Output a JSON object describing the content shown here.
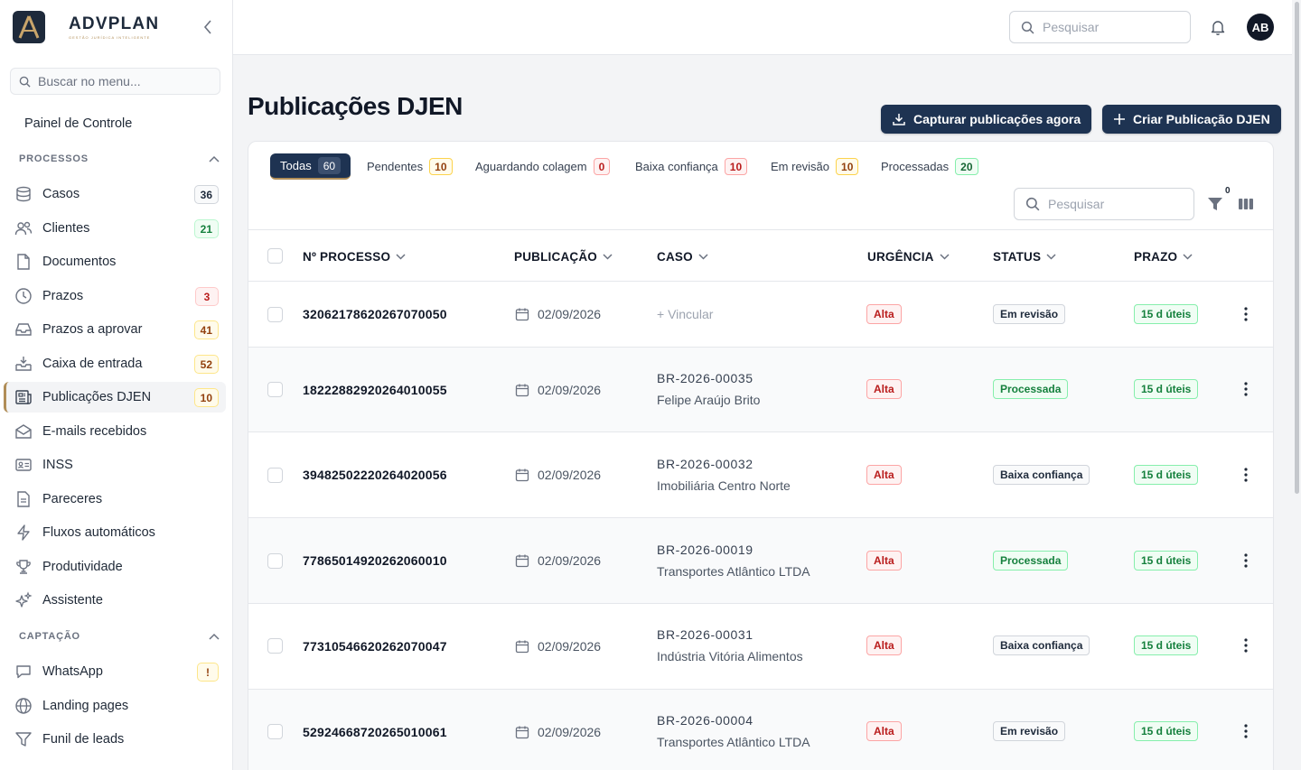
{
  "brand": {
    "name": "ADVPLAN",
    "subtitle": "GESTÃO JURÍDICA INTELIGENTE",
    "logo_letter": "A"
  },
  "sidebar": {
    "search_placeholder": "Buscar no menu...",
    "top_item": {
      "label": "Painel de Controle",
      "icon": "dashboard-icon"
    },
    "sections": [
      {
        "label": "PROCESSOS"
      },
      {
        "label": "CAPTAÇÃO"
      }
    ],
    "items": [
      {
        "label": "Casos",
        "badge": "36",
        "icon": "database-icon"
      },
      {
        "label": "Clientes",
        "badge": "21",
        "icon": "users-icon"
      },
      {
        "label": "Documentos",
        "badge": "",
        "icon": "file-icon"
      },
      {
        "label": "Prazos",
        "badge": "3",
        "icon": "clock-icon"
      },
      {
        "label": "Prazos a aprovar",
        "badge": "41",
        "icon": "inbox-icon"
      },
      {
        "label": "Caixa de entrada",
        "badge": "52",
        "icon": "inbox-download-icon"
      },
      {
        "label": "Publicações DJEN",
        "badge": "10",
        "icon": "newspaper-icon"
      },
      {
        "label": "E-mails recebidos",
        "badge": "",
        "icon": "mail-icon"
      },
      {
        "label": "INSS",
        "badge": "",
        "icon": "id-card-icon"
      },
      {
        "label": "Pareceres",
        "badge": "",
        "icon": "document-text-icon"
      },
      {
        "label": "Fluxos automáticos",
        "badge": "",
        "icon": "lightning-icon"
      },
      {
        "label": "Produtividade",
        "badge": "",
        "icon": "trophy-icon"
      },
      {
        "label": "Assistente",
        "badge": "",
        "icon": "sparkles-icon"
      },
      {
        "label": "WhatsApp",
        "badge": "!",
        "icon": "chat-icon"
      },
      {
        "label": "Landing pages",
        "badge": "",
        "icon": "globe-icon"
      },
      {
        "label": "Funil de leads",
        "badge": "",
        "icon": "funnel-icon"
      }
    ]
  },
  "topbar": {
    "search_placeholder": "Pesquisar",
    "avatar": "AB"
  },
  "page": {
    "title": "Publicações DJEN",
    "btn_capture": "Capturar publicações agora",
    "btn_create": "Criar Publicação DJEN"
  },
  "tabs": [
    {
      "label": "Todas",
      "count": "60"
    },
    {
      "label": "Pendentes",
      "count": "10"
    },
    {
      "label": "Aguardando colagem",
      "count": "0"
    },
    {
      "label": "Baixa confiança",
      "count": "10"
    },
    {
      "label": "Em revisão",
      "count": "10"
    },
    {
      "label": "Processadas",
      "count": "20"
    }
  ],
  "table": {
    "search_placeholder": "Pesquisar",
    "filter_count": "0",
    "columns": [
      "Nº PROCESSO",
      "PUBLICAÇÃO",
      "CASO",
      "URGÊNCIA",
      "STATUS",
      "PRAZO"
    ],
    "rows": [
      {
        "processo": "32062178620267070050",
        "publicacao": "02/09/2026",
        "caso_code": "",
        "caso_client": "",
        "vincular": "+ Vincular",
        "urgencia": "Alta",
        "status": "Em revisão",
        "prazo": "15 d úteis"
      },
      {
        "processo": "18222882920264010055",
        "publicacao": "02/09/2026",
        "caso_code": "BR-2026-00035",
        "caso_client": "Felipe Araújo Brito",
        "urgencia": "Alta",
        "status": "Processada",
        "prazo": "15 d úteis"
      },
      {
        "processo": "39482502220264020056",
        "publicacao": "02/09/2026",
        "caso_code": "BR-2026-00032",
        "caso_client": "Imobiliária Centro Norte",
        "urgencia": "Alta",
        "status": "Baixa confiança",
        "prazo": "15 d úteis"
      },
      {
        "processo": "77865014920262060010",
        "publicacao": "02/09/2026",
        "caso_code": "BR-2026-00019",
        "caso_client": "Transportes Atlântico LTDA",
        "urgencia": "Alta",
        "status": "Processada",
        "prazo": "15 d úteis"
      },
      {
        "processo": "77310546620262070047",
        "publicacao": "02/09/2026",
        "caso_code": "BR-2026-00031",
        "caso_client": "Indústria Vitória Alimentos",
        "urgencia": "Alta",
        "status": "Baixa confiança",
        "prazo": "15 d úteis"
      },
      {
        "processo": "52924668720265010061",
        "publicacao": "02/09/2026",
        "caso_code": "BR-2026-00004",
        "caso_client": "Transportes Atlântico LTDA",
        "urgencia": "Alta",
        "status": "Em revisão",
        "prazo": "15 d úteis"
      }
    ]
  },
  "colors": {
    "primary": "#1e3352",
    "accent": "#b08d57",
    "danger": "#b91c1c",
    "success": "#15803d"
  }
}
